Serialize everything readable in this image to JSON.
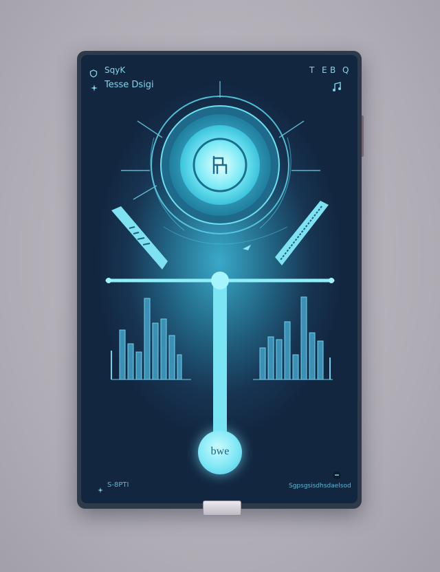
{
  "colors": {
    "accent": "#62e0f0",
    "screen_dark": "#122640",
    "frame": "#2c3a4a",
    "background": "#b9b6bf"
  },
  "header": {
    "app_label": "SqyK",
    "title": "Tesse Dsigi",
    "status_icons": [
      "T",
      "E",
      "B",
      "Q"
    ]
  },
  "center_button": {
    "icon": "chair-icon",
    "label": "bwe"
  },
  "footer": {
    "left_text": "S-8PTI",
    "right_text": "Sgpsgsisdhsdaelsod"
  }
}
